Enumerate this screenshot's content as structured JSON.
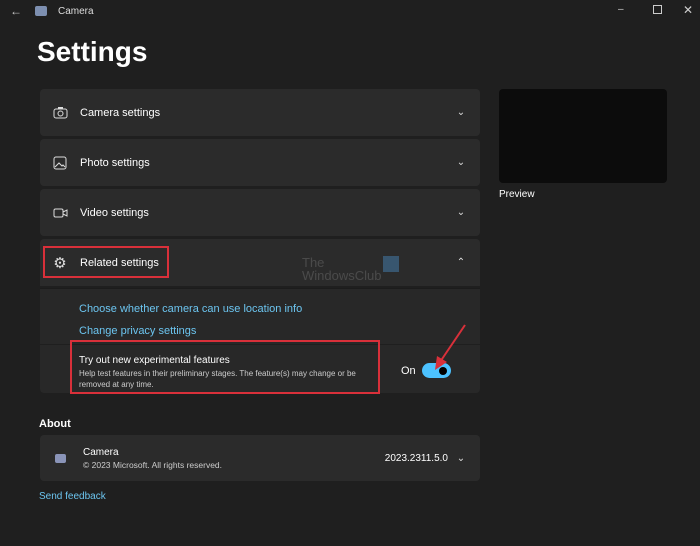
{
  "window": {
    "title": "Camera"
  },
  "page_title": "Settings",
  "sections": [
    {
      "label": "Camera settings",
      "icon": "camera-icon"
    },
    {
      "label": "Photo settings",
      "icon": "photo-icon"
    },
    {
      "label": "Video settings",
      "icon": "video-icon"
    },
    {
      "label": "Related settings",
      "icon": "gear-icon"
    }
  ],
  "related": {
    "links": [
      "Choose whether camera can use location info",
      "Change privacy settings"
    ],
    "experimental": {
      "title": "Try out new experimental features",
      "description": "Help test features in their preliminary stages. The feature(s) may change or be removed at any time.",
      "state_label": "On",
      "enabled": true
    }
  },
  "preview": {
    "label": "Preview"
  },
  "about": {
    "heading": "About",
    "app_name": "Camera",
    "copyright": "© 2023 Microsoft. All rights reserved.",
    "version": "2023.2311.5.0"
  },
  "send_feedback": "Send feedback",
  "watermark": "The WindowsClub",
  "colors": {
    "accent": "#4cc2ff",
    "link": "#6cc5f0",
    "highlight": "#d9303a"
  }
}
